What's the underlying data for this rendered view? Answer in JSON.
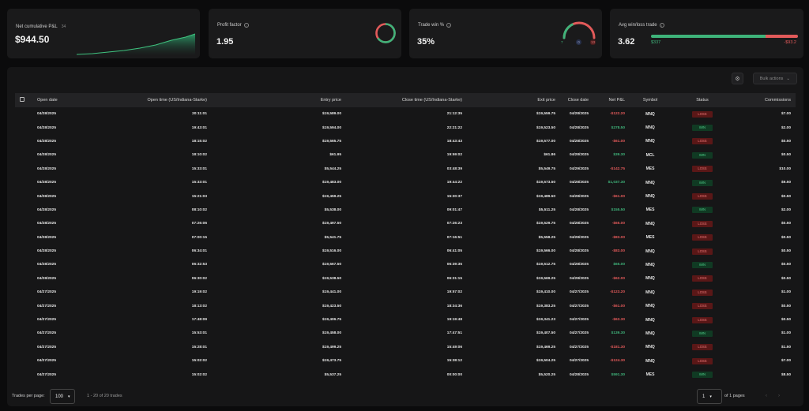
{
  "cards": {
    "pnl": {
      "label": "Net cumulative P&L",
      "badge": "34",
      "value": "$944.50"
    },
    "profit_factor": {
      "label": "Profit factor",
      "value": "1.95"
    },
    "trade_win": {
      "label": "Trade win %",
      "value": "35%",
      "wins": "7",
      "breakeven": "0",
      "losses": "13",
      "win_fraction": 0.35
    },
    "avg_win_loss": {
      "label": "Avg win/loss trade",
      "value": "3.62",
      "avg_win": "$337",
      "avg_loss": "-$93.2",
      "win_fraction": 0.78
    }
  },
  "toolbar": {
    "bulk_actions": "Bulk actions"
  },
  "table": {
    "headers": [
      "Open date",
      "Open time (US/Indiana-Starke)",
      "Entry price",
      "Close time (US/Indiana-Starke)",
      "Exit price",
      "Close date",
      "Net P&L",
      "Symbol",
      "Status",
      "Commissions"
    ],
    "rows": [
      [
        "04/28/2025",
        "20:11:01",
        "$19,589.00",
        "21:12:35",
        "$19,559.75",
        "04/28/2025",
        "-$122.20",
        "MNQ",
        "LOSS",
        "$7.00"
      ],
      [
        "04/28/2025",
        "19:43:01",
        "$19,594.00",
        "22:21:22",
        "$19,523.50",
        "04/28/2025",
        "$278.50",
        "MNQ",
        "WIN",
        "$2.00"
      ],
      [
        "04/28/2025",
        "18:15:02",
        "$19,565.75",
        "18:43:43",
        "$19,577.00",
        "04/28/2025",
        "-$61.00",
        "MNQ",
        "LOSS",
        "$0.50"
      ],
      [
        "04/28/2025",
        "18:10:02",
        "$61.95",
        "19:59:02",
        "$61.86",
        "04/28/2025",
        "$39.30",
        "MCL",
        "WIN",
        "$0.50"
      ],
      [
        "04/28/2025",
        "15:33:01",
        "$5,544.25",
        "03:48:39",
        "$5,549.75",
        "04/29/2025",
        "-$142.75",
        "MES",
        "LOSS",
        "$10.00"
      ],
      [
        "04/28/2025",
        "15:33:01",
        "$19,483.00",
        "19:44:22",
        "$19,573.50",
        "04/28/2025",
        "$1,037.30",
        "MNQ",
        "WIN",
        "$9.50"
      ],
      [
        "04/28/2025",
        "15:21:03",
        "$19,459.25",
        "15:30:37",
        "$19,489.50",
        "04/28/2025",
        "-$61.00",
        "MNQ",
        "LOSS",
        "$0.50"
      ],
      [
        "04/28/2025",
        "08:10:02",
        "$5,538.00",
        "09:01:47",
        "$5,511.25",
        "04/28/2025",
        "$155.50",
        "MES",
        "WIN",
        "$2.00"
      ],
      [
        "04/28/2025",
        "07:26:06",
        "$19,497.50",
        "07:26:23",
        "$19,529.75",
        "04/28/2025",
        "-$65.00",
        "MNQ",
        "LOSS",
        "$0.50"
      ],
      [
        "04/28/2025",
        "07:00:15",
        "$5,541.75",
        "07:16:51",
        "$5,558.25",
        "04/28/2025",
        "-$83.00",
        "MES",
        "LOSS",
        "$0.50"
      ],
      [
        "04/28/2025",
        "06:34:01",
        "$19,516.00",
        "06:41:05",
        "$19,566.00",
        "04/28/2025",
        "-$83.00",
        "MNQ",
        "LOSS",
        "$0.50"
      ],
      [
        "04/28/2025",
        "06:32:53",
        "$19,567.50",
        "06:39:35",
        "$19,512.75",
        "04/28/2025",
        "$65.00",
        "MNQ",
        "WIN",
        "$0.50"
      ],
      [
        "04/28/2025",
        "06:30:02",
        "$19,538.50",
        "06:31:15",
        "$19,569.25",
        "04/28/2025",
        "-$62.00",
        "MNQ",
        "LOSS",
        "$0.50"
      ],
      [
        "04/27/2025",
        "19:19:02",
        "$19,441.00",
        "19:57:02",
        "$19,410.00",
        "04/27/2025",
        "-$123.20",
        "MNQ",
        "LOSS",
        "$1.00"
      ],
      [
        "04/27/2025",
        "18:13:02",
        "$19,423.50",
        "18:34:36",
        "$19,383.25",
        "04/27/2025",
        "-$61.00",
        "MNQ",
        "LOSS",
        "$0.50"
      ],
      [
        "04/27/2025",
        "17:48:09",
        "$19,406.75",
        "19:19:48",
        "$19,341.23",
        "04/27/2025",
        "-$63.30",
        "MNQ",
        "LOSS",
        "$0.50"
      ],
      [
        "04/27/2025",
        "15:53:01",
        "$19,458.00",
        "17:47:51",
        "$19,407.50",
        "04/27/2025",
        "$139.30",
        "MNQ",
        "WIN",
        "$1.00"
      ],
      [
        "04/27/2025",
        "15:28:01",
        "$19,499.25",
        "15:49:06",
        "$19,469.25",
        "04/27/2025",
        "-$181.30",
        "MNQ",
        "LOSS",
        "$1.50"
      ],
      [
        "04/27/2025",
        "15:02:02",
        "$19,473.75",
        "15:38:12",
        "$19,504.25",
        "04/27/2025",
        "-$124.30",
        "MNQ",
        "LOSS",
        "$7.00"
      ],
      [
        "04/27/2025",
        "15:02:02",
        "$5,537.25",
        "00:00:00",
        "$5,520.25",
        "04/28/2025",
        "$591.30",
        "MES",
        "WIN",
        "$8.50"
      ]
    ]
  },
  "footer": {
    "per_page_label": "Trades per page:",
    "per_page_value": "100",
    "range": "1 - 20 of 20 trades",
    "page_value": "1",
    "pages_label": "of 1 pages"
  }
}
